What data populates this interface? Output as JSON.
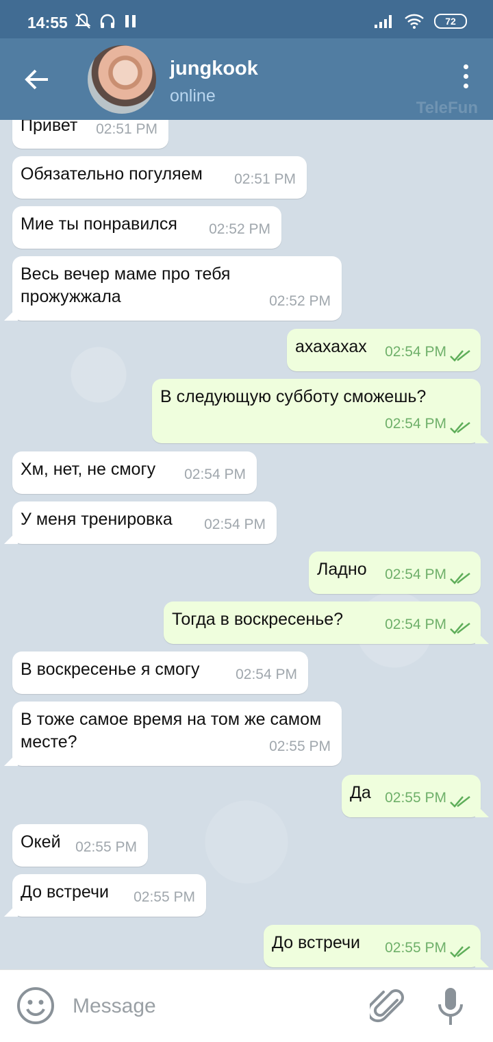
{
  "status_bar": {
    "time": "14:55",
    "battery": "72",
    "icons": [
      "mute-icon",
      "headset-icon",
      "pause-icon",
      "signal-icon",
      "wifi-icon",
      "battery-icon"
    ]
  },
  "header": {
    "contact_name": "jungkook",
    "contact_status": "online",
    "watermark": "TeleFun"
  },
  "colors": {
    "header": "#517da2",
    "status_bar": "#416c93",
    "incoming_bubble": "#ffffff",
    "outgoing_bubble": "#effedd",
    "read_check": "#5fae5a"
  },
  "messages": [
    {
      "dir": "in",
      "text": "Привет",
      "time": "02:51 PM"
    },
    {
      "dir": "in",
      "text": "Обязательно погуляем",
      "time": "02:51 PM"
    },
    {
      "dir": "in",
      "text": "Мие ты понравился",
      "time": "02:52 PM"
    },
    {
      "dir": "in",
      "text": "Весь вечер маме про тебя прожужжала",
      "time": "02:52 PM"
    },
    {
      "dir": "out",
      "text": "ахахахах",
      "time": "02:54 PM",
      "read": true
    },
    {
      "dir": "out",
      "text": "В следующую субботу сможешь?",
      "time": "02:54 PM",
      "read": true
    },
    {
      "dir": "in",
      "text": "Хм, нет, не смогу",
      "time": "02:54 PM"
    },
    {
      "dir": "in",
      "text": "У меня тренировка",
      "time": "02:54 PM"
    },
    {
      "dir": "out",
      "text": "Ладно",
      "time": "02:54 PM",
      "read": true
    },
    {
      "dir": "out",
      "text": "Тогда в воскресенье?",
      "time": "02:54 PM",
      "read": true
    },
    {
      "dir": "in",
      "text": "В воскресенье я смогу",
      "time": "02:54 PM"
    },
    {
      "dir": "in",
      "text": "В тоже самое время на том же самом месте?",
      "time": "02:55 PM"
    },
    {
      "dir": "out",
      "text": "Да",
      "time": "02:55 PM",
      "read": true
    },
    {
      "dir": "in",
      "text": "Окей",
      "time": "02:55 PM"
    },
    {
      "dir": "in",
      "text": "До встречи",
      "time": "02:55 PM"
    },
    {
      "dir": "out",
      "text": "До встречи",
      "time": "02:55 PM",
      "read": true
    }
  ],
  "input": {
    "placeholder": "Message"
  }
}
